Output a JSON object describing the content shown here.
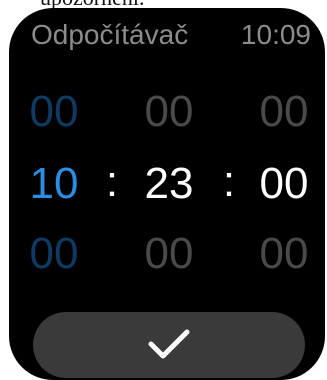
{
  "caption": "upozornění.",
  "status_bar": {
    "app_title": "Odpočítávač",
    "time": "10:09"
  },
  "picker": {
    "above": {
      "hours": "00",
      "minutes": "00",
      "seconds": "00"
    },
    "selected": {
      "hours": "10",
      "minutes": "23",
      "seconds": "00"
    },
    "below": {
      "hours": "00",
      "minutes": "00",
      "seconds": "00"
    },
    "separator": ":"
  },
  "colors": {
    "accent": "#2a8fe3",
    "accent_dim": "#0e3a63",
    "text_dim": "#4a4a4a",
    "button_bg": "#3a3a3a"
  },
  "confirm_button": {
    "icon": "check-icon"
  }
}
